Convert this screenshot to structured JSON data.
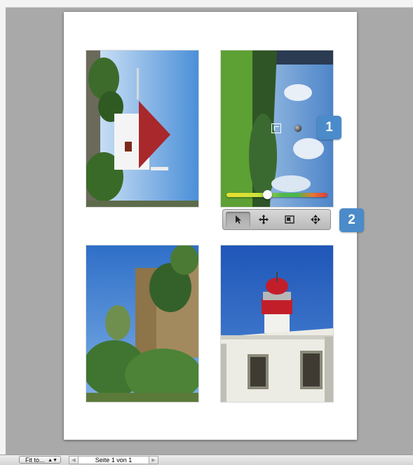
{
  "photos": [
    {
      "name": "house-with-red-roof"
    },
    {
      "name": "landscape-forest-sky"
    },
    {
      "name": "old-stone-fortress-wall"
    },
    {
      "name": "lighthouse"
    }
  ],
  "adjustment_slider": {
    "value": 0.4
  },
  "toolbar": {
    "tools": [
      "select-arrow-icon",
      "move-icon",
      "crop-icon",
      "rotate-icon"
    ]
  },
  "callouts": {
    "one": "1",
    "two": "2"
  },
  "statusbar": {
    "fit_label": "Fit to...",
    "page_indicator": "Seite 1 von 1"
  },
  "colors": {
    "callout": "#4b8bc9",
    "canvas": "#a9a9a9",
    "page": "#ffffff"
  }
}
